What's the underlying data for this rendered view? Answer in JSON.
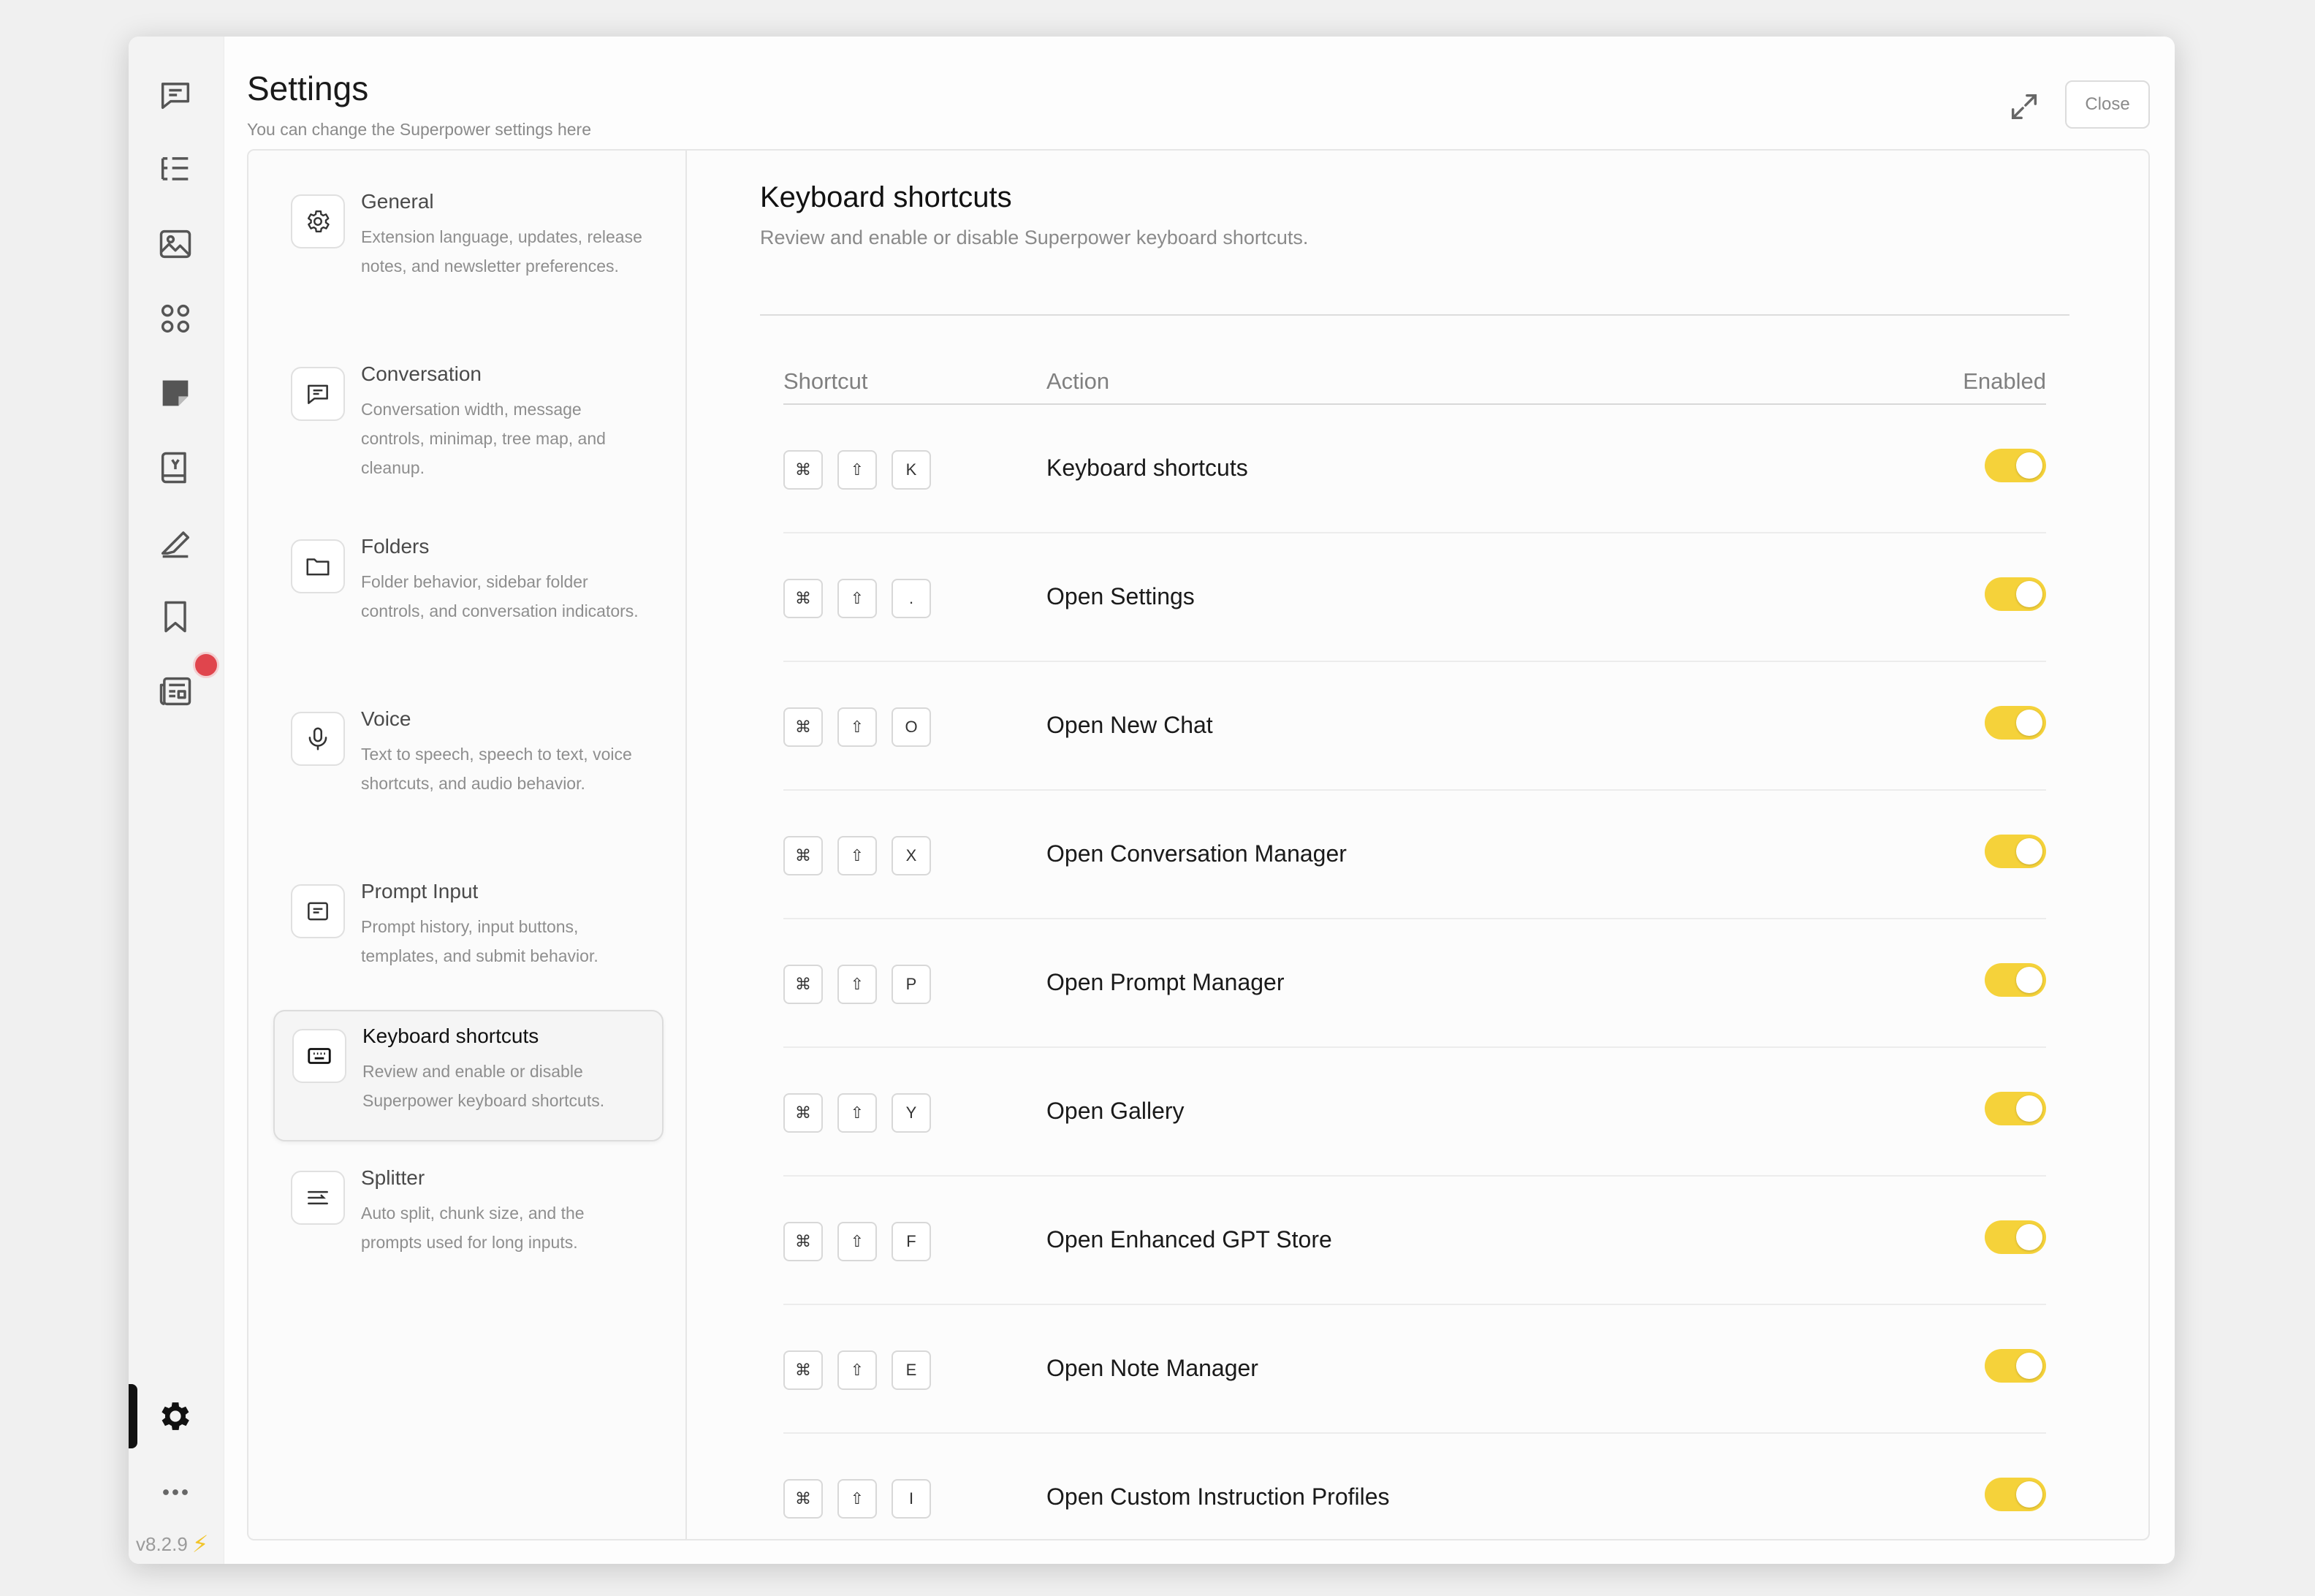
{
  "header": {
    "title": "Settings",
    "subtitle": "You can change the Superpower settings here",
    "close_label": "Close"
  },
  "rail": {
    "icons": [
      "chat-icon",
      "list-tree-icon",
      "image-icon",
      "apps-grid-icon",
      "note-icon",
      "prompt-book-icon",
      "highlighter-icon",
      "bookmark-icon",
      "newspaper-icon"
    ],
    "active": "settings-gear-icon",
    "version": "v8.2.9"
  },
  "nav": {
    "items": [
      {
        "title": "General",
        "desc": "Extension language, updates, release notes, and newsletter preferences.",
        "icon": "gear-icon"
      },
      {
        "title": "Conversation",
        "desc": "Conversation width, message controls, minimap, tree map, and cleanup.",
        "icon": "message-icon"
      },
      {
        "title": "Folders",
        "desc": "Folder behavior, sidebar folder controls, and conversation indicators.",
        "icon": "folder-icon"
      },
      {
        "title": "Voice",
        "desc": "Text to speech, speech to text, voice shortcuts, and audio behavior.",
        "icon": "microphone-icon"
      },
      {
        "title": "Prompt Input",
        "desc": "Prompt history, input buttons, templates, and submit behavior.",
        "icon": "prompt-input-icon"
      },
      {
        "title": "Keyboard shortcuts",
        "desc": "Review and enable or disable Superpower keyboard shortcuts.",
        "icon": "keyboard-icon"
      },
      {
        "title": "Splitter",
        "desc": "Auto split, chunk size, and the prompts used for long inputs.",
        "icon": "splitter-icon"
      }
    ],
    "active_index": 5
  },
  "content": {
    "title": "Keyboard shortcuts",
    "subtitle": "Review and enable or disable Superpower keyboard shortcuts.",
    "columns": {
      "shortcut": "Shortcut",
      "action": "Action",
      "enabled": "Enabled"
    },
    "rows": [
      {
        "keys": [
          "⌘",
          "⇧",
          "K"
        ],
        "action": "Keyboard shortcuts",
        "enabled": true
      },
      {
        "keys": [
          "⌘",
          "⇧",
          "."
        ],
        "action": "Open Settings",
        "enabled": true
      },
      {
        "keys": [
          "⌘",
          "⇧",
          "O"
        ],
        "action": "Open New Chat",
        "enabled": true
      },
      {
        "keys": [
          "⌘",
          "⇧",
          "X"
        ],
        "action": "Open Conversation Manager",
        "enabled": true
      },
      {
        "keys": [
          "⌘",
          "⇧",
          "P"
        ],
        "action": "Open Prompt Manager",
        "enabled": true
      },
      {
        "keys": [
          "⌘",
          "⇧",
          "Y"
        ],
        "action": "Open Gallery",
        "enabled": true
      },
      {
        "keys": [
          "⌘",
          "⇧",
          "F"
        ],
        "action": "Open Enhanced GPT Store",
        "enabled": true
      },
      {
        "keys": [
          "⌘",
          "⇧",
          "E"
        ],
        "action": "Open Note Manager",
        "enabled": true
      },
      {
        "keys": [
          "⌘",
          "⇧",
          "I"
        ],
        "action": "Open Custom Instruction Profiles",
        "enabled": true
      }
    ]
  },
  "colors": {
    "toggle_on": "#f5d23a",
    "notification": "#e0454d",
    "active_bar": "#111111"
  }
}
